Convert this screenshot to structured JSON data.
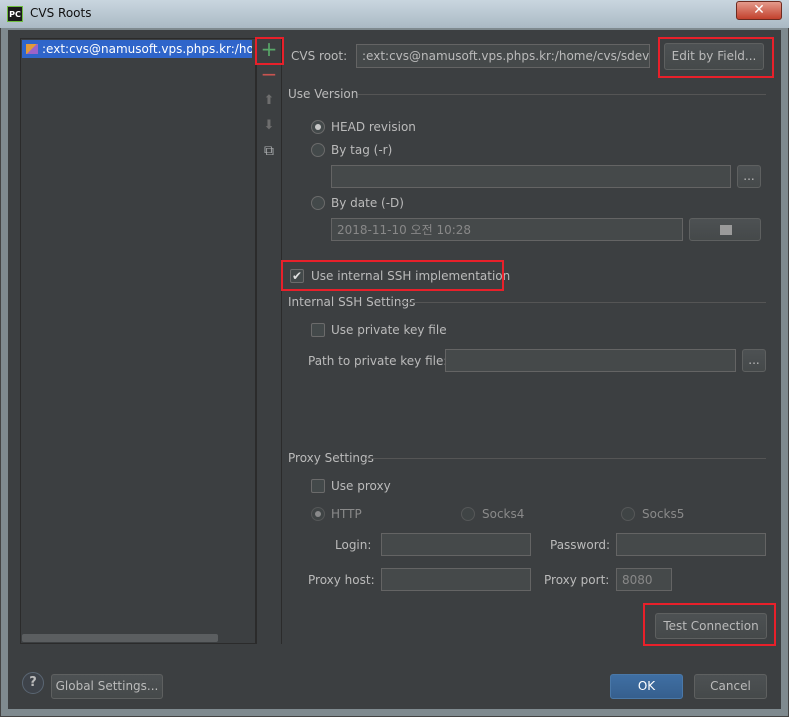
{
  "window": {
    "title": "CVS Roots",
    "app_icon_text": "PC",
    "close_glyph": "✕"
  },
  "roots": {
    "items": [
      ":ext:cvs@namusoft.vps.phps.kr:/home/cvs/sdev"
    ],
    "toolbar": {
      "add": "+",
      "remove": "−",
      "up": "⬆",
      "down": "⬇",
      "copy": "⧉"
    }
  },
  "cvs_root": {
    "label": "CVS root:",
    "value": ":ext:cvs@namusoft.vps.phps.kr:/home/cvs/sdev",
    "edit_button": "Edit by Field..."
  },
  "use_version": {
    "title": "Use Version",
    "head_revision": "HEAD revision",
    "by_tag": "By tag (-r)",
    "tag_value": "",
    "browse": "...",
    "by_date": "By date (-D)",
    "date_value": "2018-11-10 오전 10:28",
    "calendar_icon": "calendar-icon"
  },
  "ssh": {
    "use_internal": "Use internal SSH implementation",
    "title": "Internal SSH Settings",
    "use_private_key": "Use private key file",
    "path_label": "Path to private key file:",
    "path_value": "",
    "browse": "..."
  },
  "proxy": {
    "title": "Proxy Settings",
    "use_proxy": "Use proxy",
    "http": "HTTP",
    "socks4": "Socks4",
    "socks5": "Socks5",
    "login_label": "Login:",
    "password_label": "Password:",
    "host_label": "Proxy host:",
    "port_label": "Proxy port:",
    "port_value": "8080"
  },
  "test_connection": "Test Connection",
  "footer": {
    "help": "?",
    "global_settings": "Global Settings...",
    "ok": "OK",
    "cancel": "Cancel"
  },
  "colors": {
    "accent_selection": "#2f65ca",
    "highlight_box": "#e8202a",
    "add_green": "#59a869",
    "remove_red": "#c75450"
  }
}
